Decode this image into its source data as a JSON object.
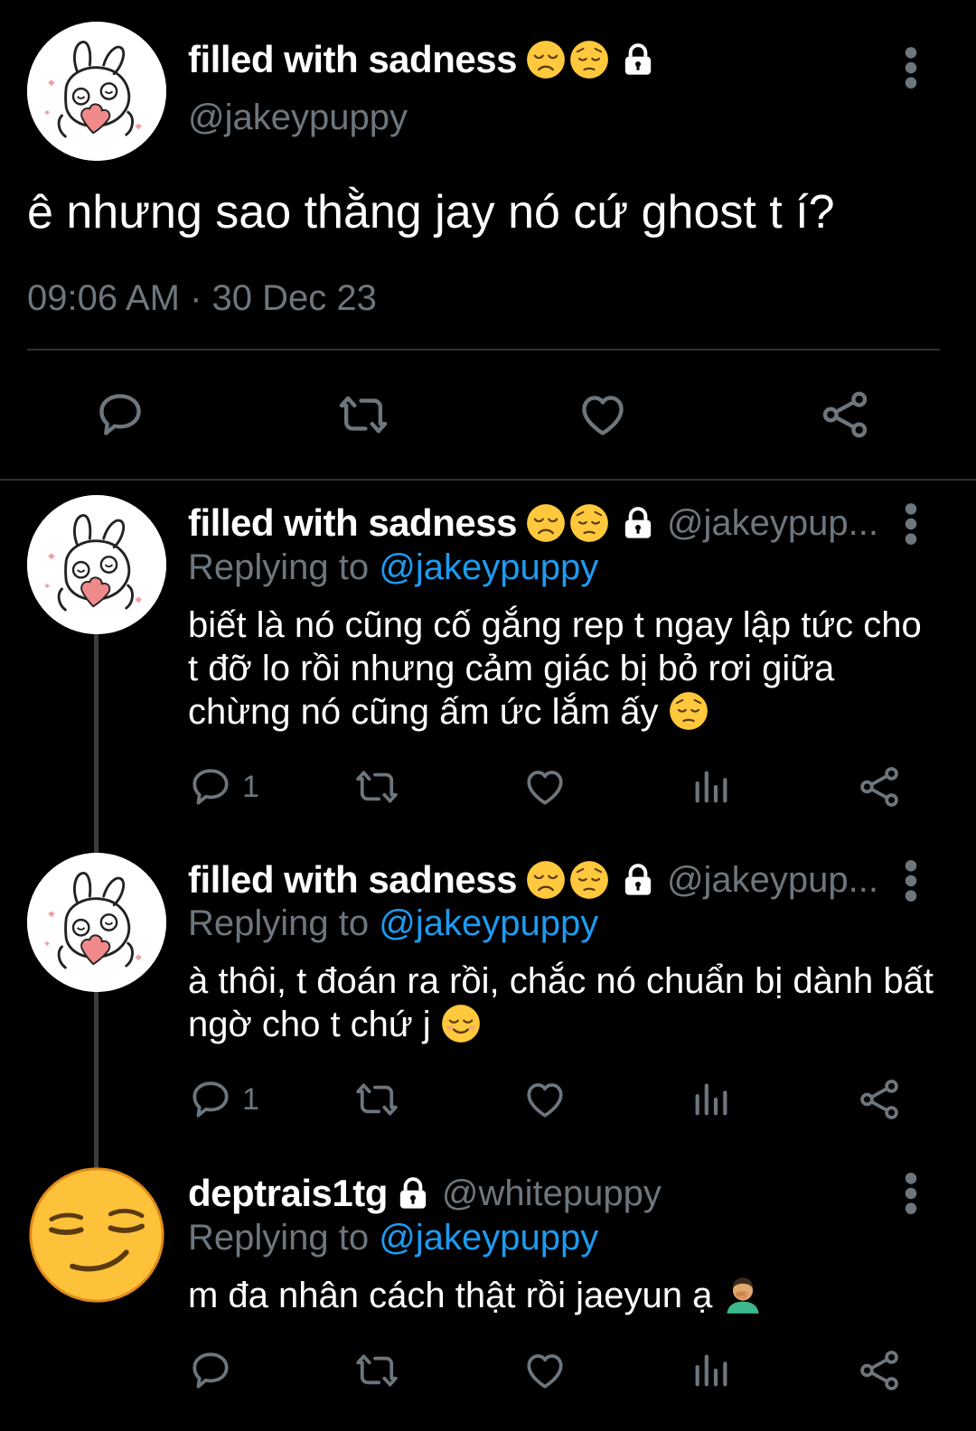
{
  "main_tweet": {
    "display_name": "filled with sadness",
    "handle": "@jakeypuppy",
    "text": "ê nhưng sao thằng jay nó cứ ghost t í?",
    "timestamp": "09:06 AM · 30 Dec 23"
  },
  "replies": [
    {
      "display_name": "filled with sadness",
      "handle": "@jakeypup...",
      "replying_label": "Replying to",
      "replying_to": "@jakeypuppy",
      "text": "biết là nó cũng cố gắng rep t ngay lập tức cho t đỡ lo rồi nhưng cảm giác bị bỏ rơi giữa chừng nó cũng ấm ức lắm ấy",
      "reply_count": "1"
    },
    {
      "display_name": "filled with sadness",
      "handle": "@jakeypup...",
      "replying_label": "Replying to",
      "replying_to": "@jakeypuppy",
      "text": "à thôi, t đoán ra rồi, chắc nó chuẩn bị dành bất ngờ cho t chứ j",
      "reply_count": "1"
    },
    {
      "display_name": "deptrais1tg",
      "handle": "@whitepuppy",
      "replying_label": "Replying to",
      "replying_to": "@jakeypuppy",
      "text": "m đa nhân cách thật rồi jaeyun ạ",
      "reply_count": ""
    }
  ],
  "colors": {
    "background": "#000000",
    "text_primary": "#ffffff",
    "text_secondary": "#6e767d",
    "link": "#1d9bf0",
    "divider": "#2f3336",
    "thread_line": "#3a3d40"
  },
  "icons": [
    "more-vert-icon",
    "lock-icon",
    "reply-icon",
    "retweet-icon",
    "like-icon",
    "share-icon",
    "views-icon",
    "disappointed-emoji",
    "pensive-emoji",
    "relieved-emoji",
    "facepalm-emoji",
    "smirk-emoji"
  ]
}
